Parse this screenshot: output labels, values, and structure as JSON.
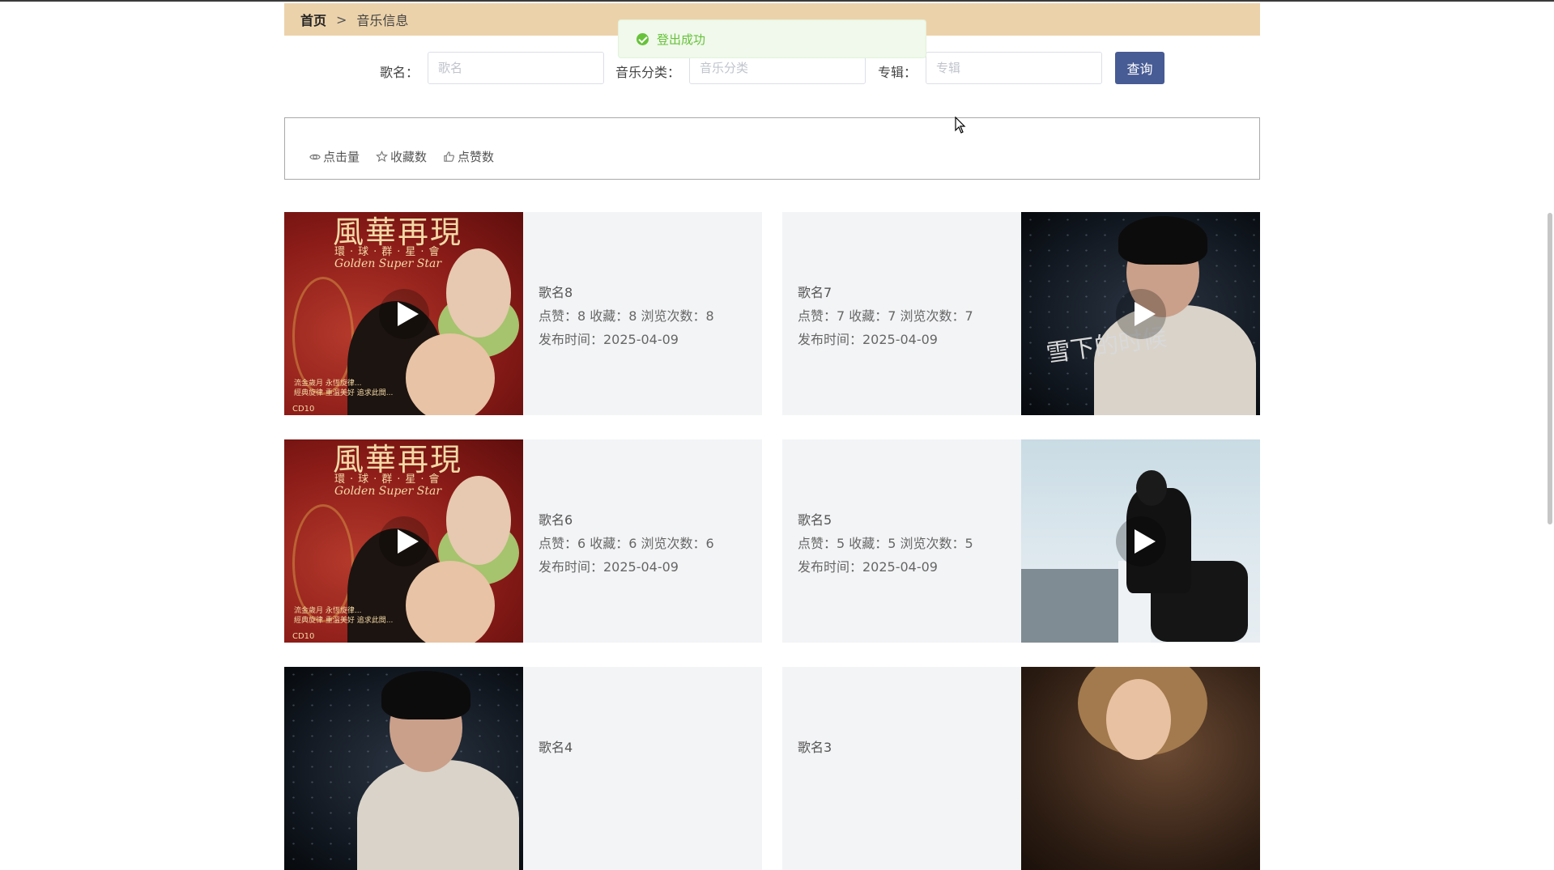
{
  "breadcrumb": {
    "home": "首页",
    "separator": ">",
    "current": "音乐信息"
  },
  "toast": {
    "message": "登出成功",
    "icon": "check-circle-icon",
    "color": "#67c23a"
  },
  "search": {
    "song_label": "歌名：",
    "song_placeholder": "歌名",
    "category_label": "音乐分类：",
    "category_placeholder": "音乐分类",
    "album_label": "专辑：",
    "album_placeholder": "专辑",
    "query_button": "查询"
  },
  "sort": [
    {
      "label": "点击量",
      "icon": "eye-icon"
    },
    {
      "label": "收藏数",
      "icon": "star-icon"
    },
    {
      "label": "点赞数",
      "icon": "thumbs-up-icon"
    }
  ],
  "songs": [
    {
      "title": "歌名8",
      "stats": "点赞：8  收藏：8  浏览次数：8",
      "date": "发布时间：2025-04-09"
    },
    {
      "title": "歌名7",
      "stats": "点赞：7  收藏：7  浏览次数：7",
      "date": "发布时间：2025-04-09"
    },
    {
      "title": "歌名6",
      "stats": "点赞：6  收藏：6  浏览次数：6",
      "date": "发布时间：2025-04-09"
    },
    {
      "title": "歌名5",
      "stats": "点赞：5  收藏：5  浏览次数：5",
      "date": "发布时间：2025-04-09"
    },
    {
      "title": "歌名4",
      "stats": "",
      "date": ""
    },
    {
      "title": "歌名3",
      "stats": "",
      "date": ""
    }
  ],
  "cover_art": {
    "title": "風華再現",
    "subtitle": "環·球·群·星·會",
    "english": "Golden Super Star",
    "footer_line1": "流金歲月 永恆旋律...",
    "footer_line2": "經典旋律 重溫美好 追求此間...",
    "disc": "CD10",
    "handwriting": "雪下的时候"
  },
  "colors": {
    "accent": "#475b94",
    "breadcrumb_bg": "#ecd2aa",
    "card_bg": "#f3f4f6"
  }
}
